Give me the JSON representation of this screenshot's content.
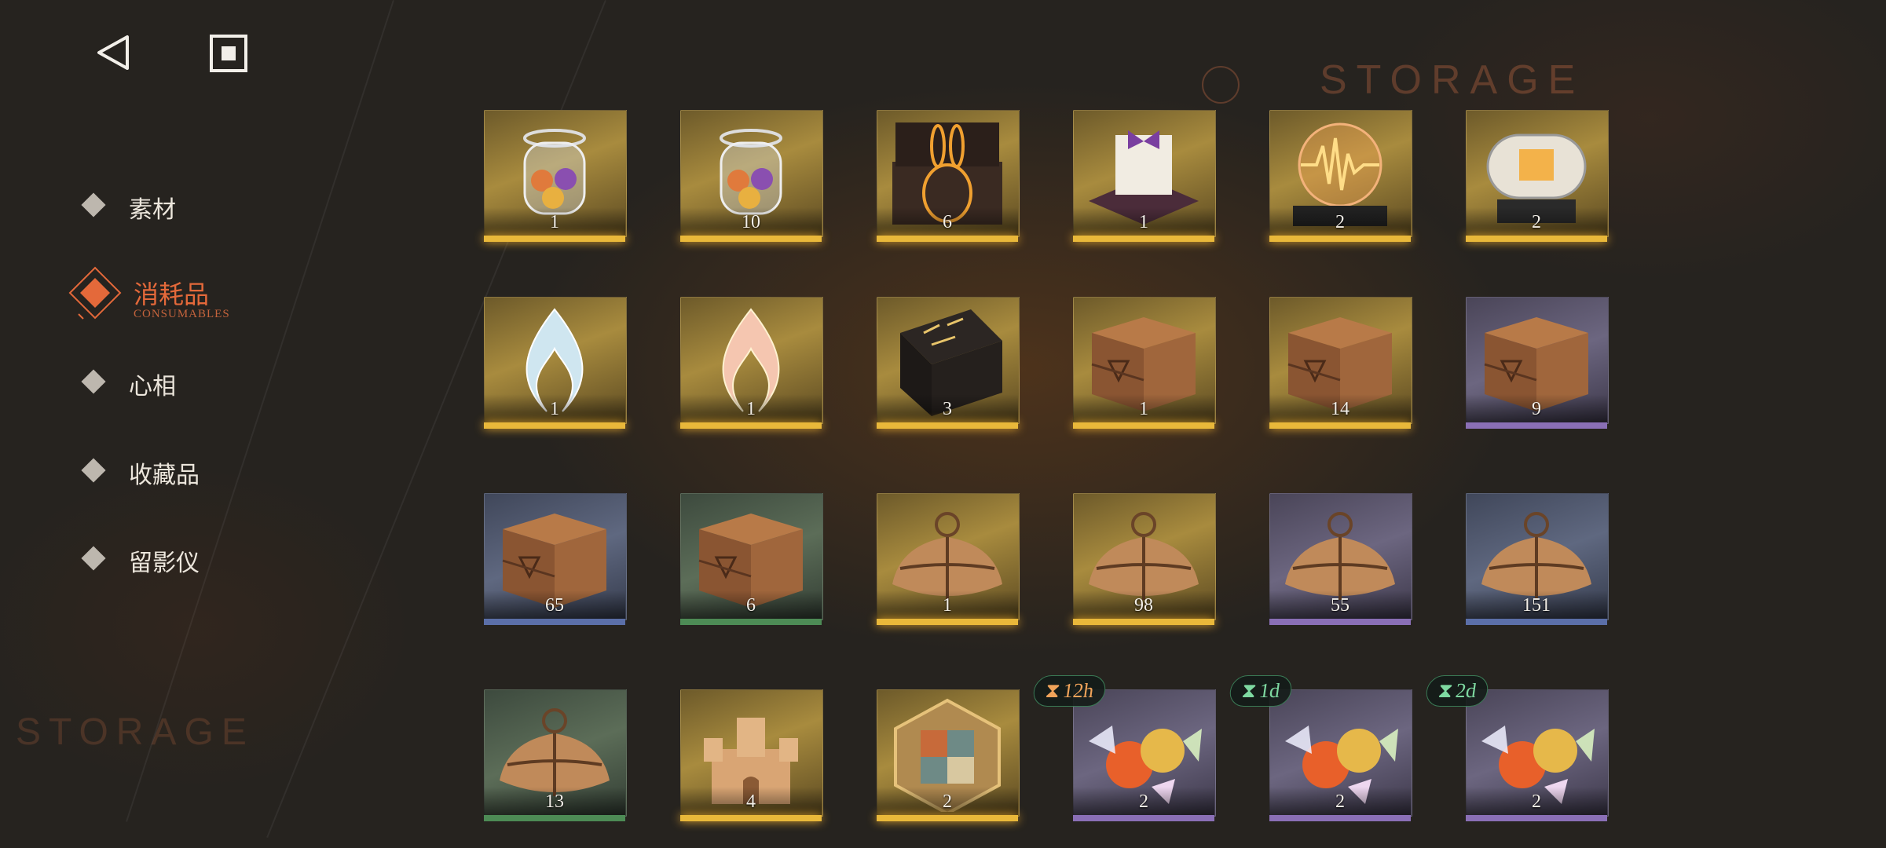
{
  "header": {
    "back_icon": "back-triangle-icon",
    "home_icon": "square-home-icon",
    "watermark": "STORAGE"
  },
  "sidebar": {
    "items": [
      {
        "label": "素材",
        "active": false
      },
      {
        "label": "消耗品",
        "sub": "CONSUMABLES",
        "active": true
      },
      {
        "label": "心相",
        "active": false
      },
      {
        "label": "收藏品",
        "active": false
      },
      {
        "label": "留影仪",
        "active": false
      }
    ]
  },
  "colors": {
    "accent": "#e4693a",
    "quality_gold": "#e9b83a",
    "quality_purple": "#8a6fb6",
    "quality_blue": "#5b6fa8",
    "quality_green": "#4d8b55",
    "timer_orange": "#f0a35a",
    "timer_green": "#7ed9a1"
  },
  "items": [
    {
      "icon": "jar-of-orbs-icon",
      "count": "1",
      "quality": "gold"
    },
    {
      "icon": "jar-of-orbs-icon",
      "count": "10",
      "quality": "gold"
    },
    {
      "icon": "rabbit-box-icon",
      "count": "6",
      "quality": "gold"
    },
    {
      "icon": "gift-book-icon",
      "count": "1",
      "quality": "gold"
    },
    {
      "icon": "soundwave-globe-icon",
      "count": "2",
      "quality": "gold"
    },
    {
      "icon": "capsule-machine-icon",
      "count": "2",
      "quality": "gold"
    },
    {
      "icon": "blue-flame-icon",
      "count": "1",
      "quality": "gold"
    },
    {
      "icon": "pink-flame-icon",
      "count": "1",
      "quality": "gold"
    },
    {
      "icon": "rune-table-icon",
      "count": "3",
      "quality": "gold"
    },
    {
      "icon": "wooden-crate-icon",
      "count": "1",
      "quality": "gold"
    },
    {
      "icon": "wooden-crate-icon",
      "count": "14",
      "quality": "gold"
    },
    {
      "icon": "wooden-crate-icon",
      "count": "9",
      "quality": "purple"
    },
    {
      "icon": "wooden-crate-icon",
      "count": "65",
      "quality": "blue"
    },
    {
      "icon": "wooden-crate-icon",
      "count": "6",
      "quality": "green"
    },
    {
      "icon": "parcel-icon",
      "count": "1",
      "quality": "gold"
    },
    {
      "icon": "parcel-icon",
      "count": "98",
      "quality": "gold"
    },
    {
      "icon": "parcel-icon",
      "count": "55",
      "quality": "purple"
    },
    {
      "icon": "parcel-icon",
      "count": "151",
      "quality": "blue"
    },
    {
      "icon": "parcel-icon",
      "count": "13",
      "quality": "green"
    },
    {
      "icon": "sand-castle-icon",
      "count": "4",
      "quality": "gold"
    },
    {
      "icon": "hex-puzzle-icon",
      "count": "2",
      "quality": "gold"
    },
    {
      "icon": "candy-icon",
      "count": "2",
      "quality": "purple",
      "timer": "12h",
      "timer_color": "orange"
    },
    {
      "icon": "candy-icon",
      "count": "2",
      "quality": "purple",
      "timer": "1d",
      "timer_color": "green"
    },
    {
      "icon": "candy-icon",
      "count": "2",
      "quality": "purple",
      "timer": "2d",
      "timer_color": "green"
    }
  ]
}
